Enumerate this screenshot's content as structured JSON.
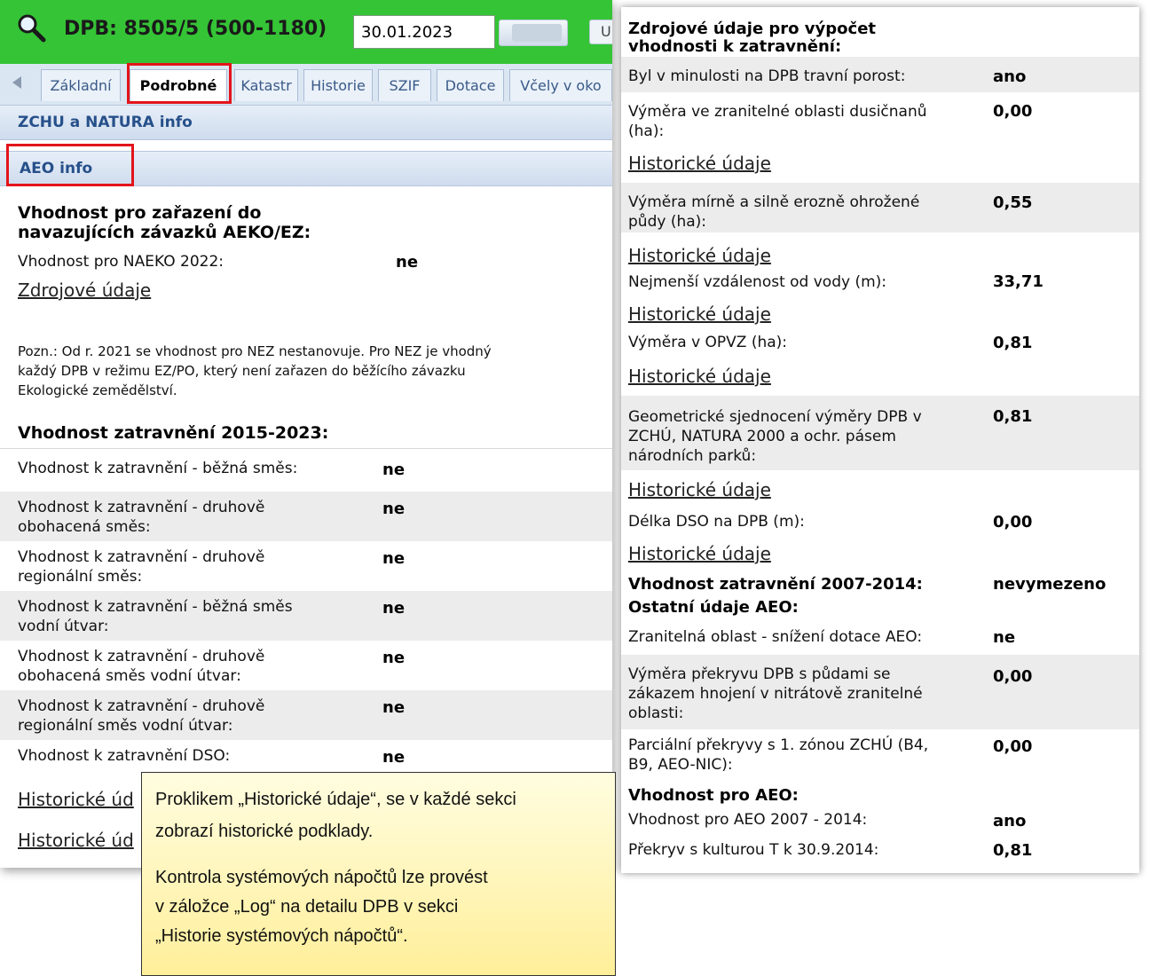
{
  "header": {
    "title": "DPB: 8505/5 (500-1180)",
    "date_value": "30.01.2023",
    "button_partial": "U"
  },
  "tabs": [
    {
      "label": "Základní"
    },
    {
      "label": "Podrobné"
    },
    {
      "label": "Katastr"
    },
    {
      "label": "Historie"
    },
    {
      "label": "SZIF"
    },
    {
      "label": "Dotace"
    },
    {
      "label": "Včely v oko"
    }
  ],
  "sections": {
    "zchu": "ZCHU a NATURA info",
    "aeo": "AEO info"
  },
  "left": {
    "heading1_line1": "Vhodnost pro zařazení do",
    "heading1_line2": "navazujících závazků AEKO/EZ:",
    "naeko_label": "Vhodnost pro NAEKO 2022:",
    "naeko_value": "ne",
    "source_link": "Zdrojové údaje",
    "note_line1": "Pozn.: Od r. 2021 se vhodnost pro NEZ nestanovuje. Pro NEZ je vhodný",
    "note_line2": "každý DPB v režimu EZ/PO, který není zařazen do běžícího závazku",
    "note_line3": "Ekologické zemědělství.",
    "heading2": "Vhodnost zatravnění 2015-2023:",
    "rows": [
      {
        "l1": "Vhodnost k zatravnění - běžná směs:",
        "l2": "",
        "value": "ne"
      },
      {
        "l1": "Vhodnost k zatravnění - druhově",
        "l2": "obohacená směs:",
        "value": "ne"
      },
      {
        "l1": "Vhodnost k zatravnění - druhově",
        "l2": "regionální směs:",
        "value": "ne"
      },
      {
        "l1": "Vhodnost k zatravnění - běžná směs",
        "l2": "vodní útvar:",
        "value": "ne"
      },
      {
        "l1": "Vhodnost k zatravnění - druhově",
        "l2": "obohacená směs vodní útvar:",
        "value": "ne"
      },
      {
        "l1": "Vhodnost k zatravnění - druhově",
        "l2": "regionální směs vodní útvar:",
        "value": "ne"
      },
      {
        "l1": "Vhodnost k zatravnění DSO:",
        "l2": "",
        "value": "ne"
      }
    ],
    "hist_link_1": "Historické úd",
    "hist_link_2": "Historické úd"
  },
  "right": {
    "title_line1": "Zdrojové údaje pro výpočet",
    "title_line2": "vhodnosti k zatravnění:",
    "row1_label": "Byl v minulosti na DPB travní porost:",
    "row1_value": "ano",
    "row2_label1": "Výměra ve zranitelné oblasti dusičnanů",
    "row2_label2": "(ha):",
    "row2_value": "0,00",
    "hist_link": "Historické údaje",
    "row3_label1": "Výměra mírně a silně erozně ohrožené",
    "row3_label2": "půdy (ha):",
    "row3_value": "0,55",
    "row4_label": "Nejmenší vzdálenost od vody (m):",
    "row4_value": "33,71",
    "row5_label": "Výměra v OPVZ (ha):",
    "row5_value": "0,81",
    "row6_label1": "Geometrické sjednocení výměry DPB v",
    "row6_label2": "ZCHÚ, NATURA 2000 a ochr. pásem",
    "row6_label3": "národních parků:",
    "row6_value": "0,81",
    "row7_label": "Délka DSO na DPB (m):",
    "row7_value": "0,00",
    "vz_label": "Vhodnost zatravnění 2007-2014:",
    "vz_value": "nevymezeno",
    "other_heading": "Ostatní údaje AEO:",
    "row8_label": "Zranitelná oblast - snížení dotace AEO:",
    "row8_value": "ne",
    "row9_label1": "Výměra překryvu DPB s půdami se",
    "row9_label2": "zákazem hnojení v nitrátově zranitelné",
    "row9_label3": "oblasti:",
    "row9_value": "0,00",
    "row10_label1": "Parciální překryvy s 1. zónou ZCHÚ (B4,",
    "row10_label2": "B9, AEO-NIC):",
    "row10_value": "0,00",
    "aeo_heading": "Vhodnost pro AEO:",
    "row11_label": "Vhodnost pro AEO 2007 - 2014:",
    "row11_value": "ano",
    "row12_label": "Překryv s kulturou T k 30.9.2014:",
    "row12_value": "0,81"
  },
  "tooltip": {
    "line1": "Proklikem „Historické údaje“, se v každé sekci",
    "line2": "zobrazí historické podklady.",
    "line3": "Kontrola systémových nápočtů lze provést",
    "line4": "v záložce „Log“ na detailu DPB v sekci",
    "line5": "„Historie systémových nápočtů“."
  }
}
